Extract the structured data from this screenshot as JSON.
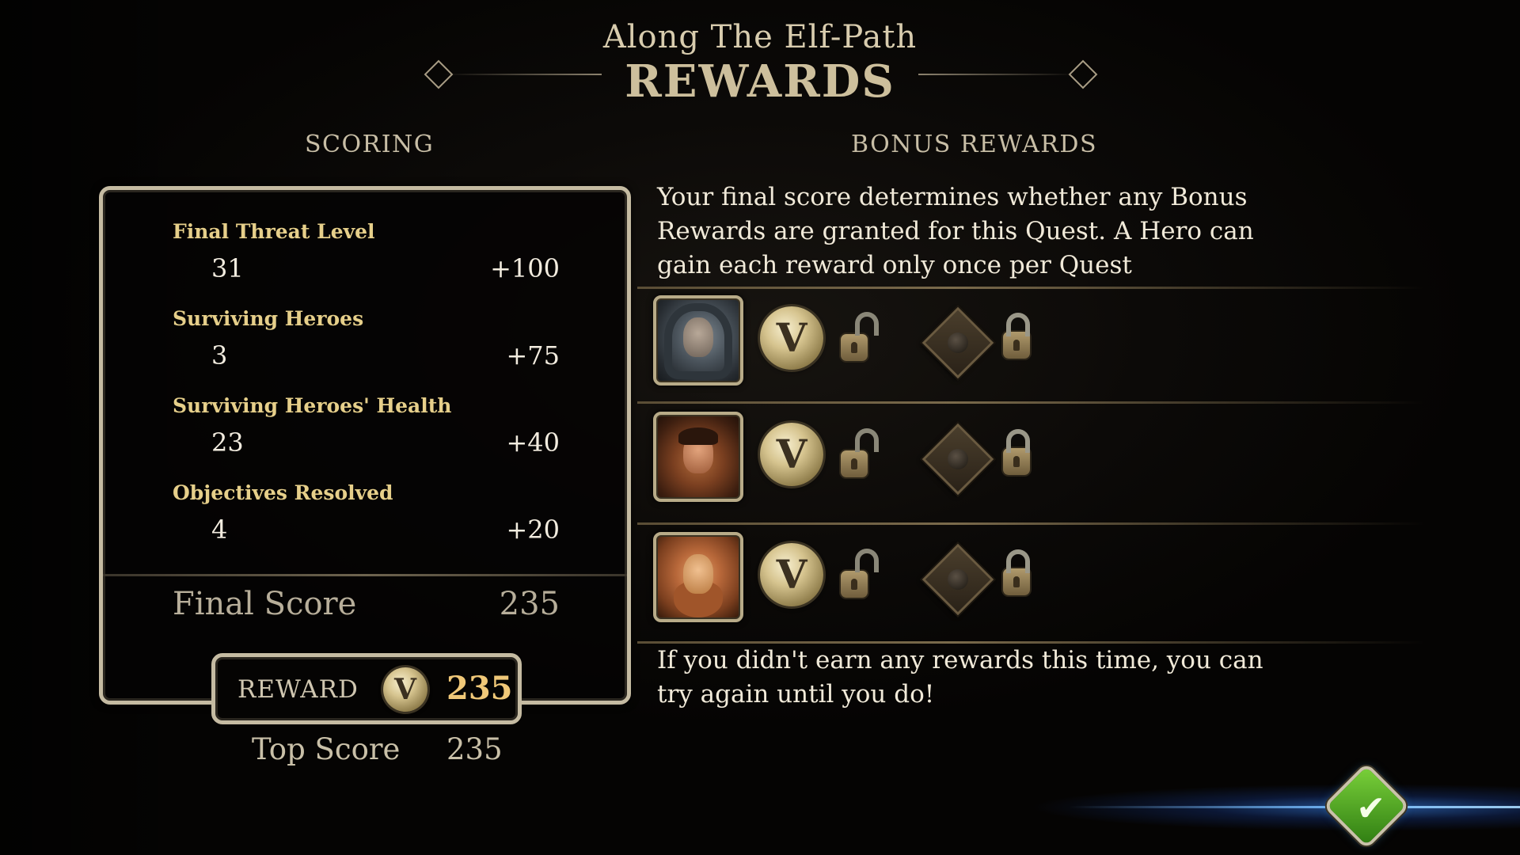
{
  "header": {
    "quest_name": "Along The Elf-Path",
    "screen_title": "REWARDS"
  },
  "scoring": {
    "title": "SCORING",
    "rows": [
      {
        "label": "Final Threat Level",
        "count": "31",
        "points": "+100"
      },
      {
        "label": "Surviving Heroes",
        "count": "3",
        "points": "+75"
      },
      {
        "label": "Surviving Heroes' Health",
        "count": "23",
        "points": "+40"
      },
      {
        "label": "Objectives Resolved",
        "count": "4",
        "points": "+20"
      }
    ],
    "final_score_label": "Final Score",
    "final_score_value": "235",
    "reward_label": "REWARD",
    "reward_coin": "V",
    "reward_value": "235",
    "top_score_label": "Top Score",
    "top_score_value": "235"
  },
  "bonus": {
    "title": "BONUS REWARDS",
    "intro": "Your final score determines whether any Bonus Rewards are granted for this Quest. A Hero can gain each reward only once per Quest",
    "outro": "If you didn't earn any rewards this time, you can try again until you do!",
    "heroes": [
      {
        "portrait": "hooded-hero-portrait",
        "coin": "V",
        "reward1_state": "unlocked",
        "reward2_state": "locked"
      },
      {
        "portrait": "young-hero-portrait",
        "coin": "V",
        "reward1_state": "unlocked",
        "reward2_state": "locked"
      },
      {
        "portrait": "dwarf-hero-portrait",
        "coin": "V",
        "reward1_state": "unlocked",
        "reward2_state": "locked"
      }
    ]
  },
  "confirm": {
    "icon": "checkmark-icon",
    "color": "#5cb82a"
  },
  "colors": {
    "gold_label": "#e6cf8a",
    "reward_value": "#f0c878",
    "panel_border": "#c5bba2",
    "glow": "#4a9cff"
  }
}
